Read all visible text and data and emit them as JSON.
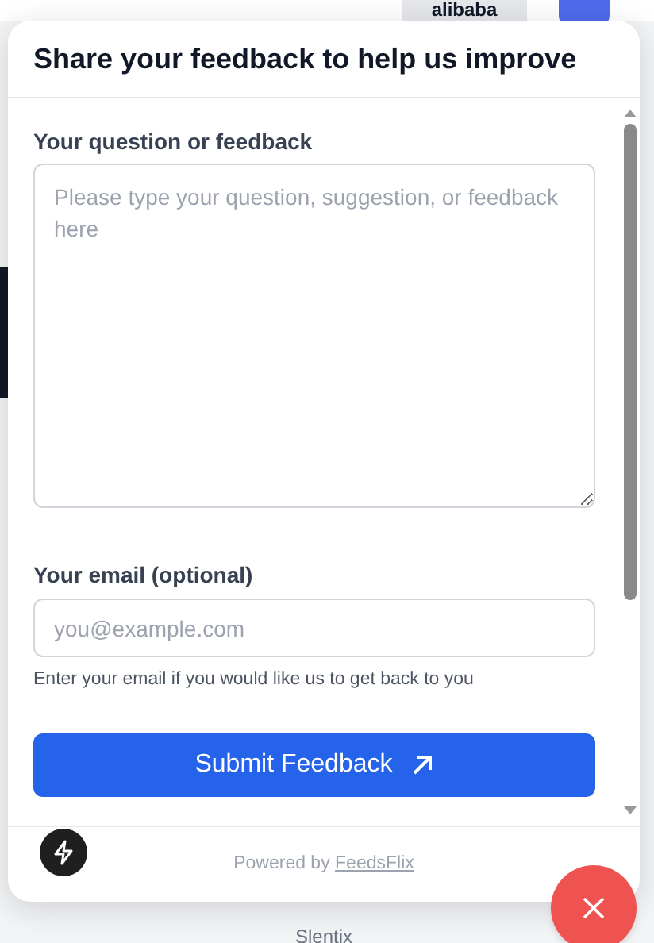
{
  "background": {
    "tab": "alibaba",
    "footer_text": "Slentix"
  },
  "popup": {
    "title": "Share your feedback to help us improve",
    "question": {
      "label": "Your question or feedback",
      "placeholder": "Please type your question, suggestion, or feedback here"
    },
    "email": {
      "label": "Your email (optional)",
      "placeholder": "you@example.com",
      "hint": "Enter your email if you would like us to get back to you"
    },
    "submit": "Submit Feedback",
    "footer": {
      "prefix": "Powered by",
      "link": "FeedsFlix"
    }
  }
}
